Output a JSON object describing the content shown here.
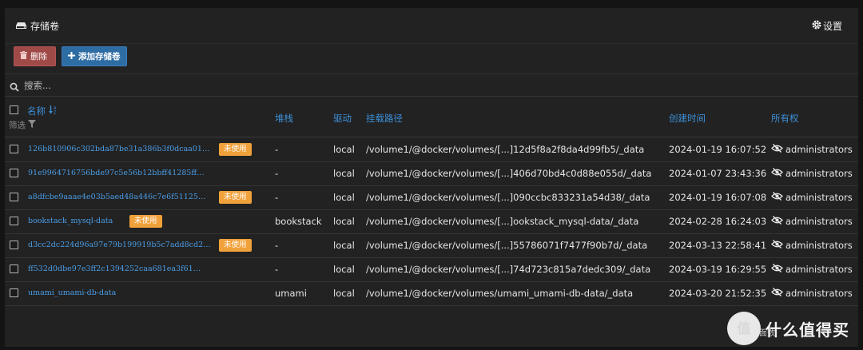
{
  "header": {
    "title": "存储卷",
    "settings_label": "设置"
  },
  "toolbar": {
    "delete_label": "删除",
    "add_label": "添加存储卷"
  },
  "search": {
    "placeholder": "搜索..."
  },
  "table": {
    "columns": {
      "name": "名称",
      "stack": "堆栈",
      "driver": "驱动",
      "mount": "挂载路径",
      "created": "创建时间",
      "owner": "所有权"
    },
    "filter_label": "筛选",
    "rows": [
      {
        "name": "126b810906c302bda87be31a386b3f0dcaa01…",
        "badge": "未使用",
        "stack": "-",
        "driver": "local",
        "mount": "/volume1/@docker/volumes/[...]12d5f8a2f8da4d99fb5/_data",
        "created": "2024-01-19 16:07:52",
        "owner": "administrators"
      },
      {
        "name": "91e9964716756bde97c5e56b12bbff41285ff…",
        "badge": "",
        "stack": "-",
        "driver": "local",
        "mount": "/volume1/@docker/volumes/[...]406d70bd4c0d88e055d/_data",
        "created": "2024-01-07 23:43:36",
        "owner": "administrators"
      },
      {
        "name": "a8dfcbe9aaae4e03b5aed48a446c7e6f51125…",
        "badge": "未使用",
        "stack": "-",
        "driver": "local",
        "mount": "/volume1/@docker/volumes/[...]090ccbc833231a54d38/_data",
        "created": "2024-01-19 16:07:08",
        "owner": "administrators"
      },
      {
        "name": "bookstack_mysql-data",
        "badge": "未使用",
        "stack": "bookstack",
        "driver": "local",
        "mount": "/volume1/@docker/volumes/[...]ookstack_mysql-data/_data",
        "created": "2024-02-28 16:24:03",
        "owner": "administrators"
      },
      {
        "name": "d3cc2dc224d96a97e79b199919b5c7add8cd2…",
        "badge": "未使用",
        "stack": "-",
        "driver": "local",
        "mount": "/volume1/@docker/volumes/[...]55786071f7477f90b7d/_data",
        "created": "2024-03-13 22:58:41",
        "owner": "administrators"
      },
      {
        "name": "ff532d0dbe97e3ff2c1394252caa681ea3f61…",
        "badge": "",
        "stack": "-",
        "driver": "local",
        "mount": "/volume1/@docker/volumes/[...]74d723c815a7dedc309/_data",
        "created": "2024-03-19 16:29:55",
        "owner": "administrators"
      },
      {
        "name": "umami_umami-db-data",
        "badge": "",
        "stack": "umami",
        "driver": "local",
        "mount": "/volume1/@docker/volumes/umami_umami-db-data/_data",
        "created": "2024-03-20 21:52:35",
        "owner": "administrators"
      }
    ]
  },
  "footer": {
    "text": "页面数"
  },
  "watermark": {
    "text": "什么值得买",
    "logo_glyph": "值"
  },
  "colors": {
    "link": "#4a9ee8",
    "header_blue": "#3d8fd8",
    "badge": "#f0a13a",
    "delete": "#a04a48",
    "add": "#2e6da4"
  },
  "icons": {
    "title": "hdd-icon",
    "settings": "gear-icon",
    "delete": "trash-icon",
    "add": "plus-icon",
    "search": "search-icon",
    "sort": "sort-alpha-icon",
    "filter": "filter-icon",
    "owner": "eye-slash-icon"
  }
}
